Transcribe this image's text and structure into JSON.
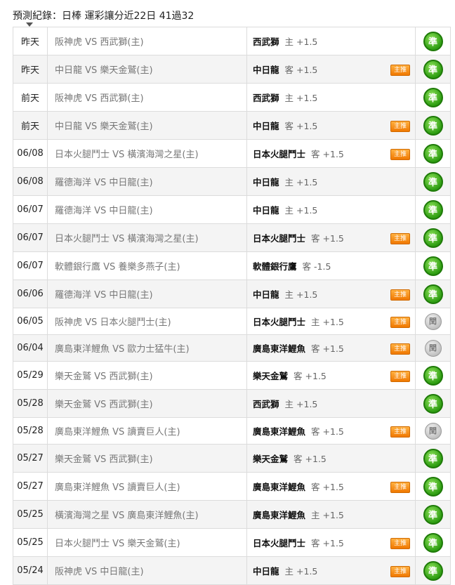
{
  "header": {
    "title": "預測紀錄：日棒 運彩讓分近22日 41過32"
  },
  "rows": [
    {
      "date": "昨天",
      "match": "阪神虎 VS 西武獅(主)",
      "pick": "西武獅",
      "side": "主",
      "line": "+1.5",
      "badge": "",
      "result": "準",
      "result_type": "win"
    },
    {
      "date": "昨天",
      "match": "中日龍 VS 樂天金鷲(主)",
      "pick": "中日龍",
      "side": "客",
      "line": "+1.5",
      "badge": "主推",
      "result": "準",
      "result_type": "win"
    },
    {
      "date": "前天",
      "match": "阪神虎 VS 西武獅(主)",
      "pick": "西武獅",
      "side": "主",
      "line": "+1.5",
      "badge": "",
      "result": "準",
      "result_type": "win"
    },
    {
      "date": "前天",
      "match": "中日龍 VS 樂天金鷲(主)",
      "pick": "中日龍",
      "side": "客",
      "line": "+1.5",
      "badge": "主推",
      "result": "準",
      "result_type": "win"
    },
    {
      "date": "06/08",
      "match": "日本火腿鬥士 VS 橫濱海灣之星(主)",
      "pick": "日本火腿鬥士",
      "side": "客",
      "line": "+1.5",
      "badge": "主推",
      "result": "準",
      "result_type": "win"
    },
    {
      "date": "06/08",
      "match": "羅德海洋 VS 中日龍(主)",
      "pick": "中日龍",
      "side": "主",
      "line": "+1.5",
      "badge": "",
      "result": "準",
      "result_type": "win"
    },
    {
      "date": "06/07",
      "match": "羅德海洋 VS 中日龍(主)",
      "pick": "中日龍",
      "side": "主",
      "line": "+1.5",
      "badge": "",
      "result": "準",
      "result_type": "win"
    },
    {
      "date": "06/07",
      "match": "日本火腿鬥士 VS 橫濱海灣之星(主)",
      "pick": "日本火腿鬥士",
      "side": "客",
      "line": "+1.5",
      "badge": "主推",
      "result": "準",
      "result_type": "win"
    },
    {
      "date": "06/07",
      "match": "軟體銀行鷹 VS 養樂多燕子(主)",
      "pick": "軟體銀行鷹",
      "side": "客",
      "line": "-1.5",
      "badge": "",
      "result": "準",
      "result_type": "win"
    },
    {
      "date": "06/06",
      "match": "羅德海洋 VS 中日龍(主)",
      "pick": "中日龍",
      "side": "主",
      "line": "+1.5",
      "badge": "主推",
      "result": "準",
      "result_type": "win"
    },
    {
      "date": "06/05",
      "match": "阪神虎 VS 日本火腿鬥士(主)",
      "pick": "日本火腿鬥士",
      "side": "主",
      "line": "+1.5",
      "badge": "主推",
      "result": "閏",
      "result_type": "push"
    },
    {
      "date": "06/04",
      "match": "廣島東洋鯉魚 VS 歐力士猛牛(主)",
      "pick": "廣島東洋鯉魚",
      "side": "客",
      "line": "+1.5",
      "badge": "主推",
      "result": "閏",
      "result_type": "push"
    },
    {
      "date": "05/29",
      "match": "樂天金鷲 VS 西武獅(主)",
      "pick": "樂天金鷲",
      "side": "客",
      "line": "+1.5",
      "badge": "主推",
      "result": "準",
      "result_type": "win"
    },
    {
      "date": "05/28",
      "match": "樂天金鷲 VS 西武獅(主)",
      "pick": "西武獅",
      "side": "主",
      "line": "+1.5",
      "badge": "",
      "result": "準",
      "result_type": "win"
    },
    {
      "date": "05/28",
      "match": "廣島東洋鯉魚 VS 讀賣巨人(主)",
      "pick": "廣島東洋鯉魚",
      "side": "客",
      "line": "+1.5",
      "badge": "主推",
      "result": "閏",
      "result_type": "push"
    },
    {
      "date": "05/27",
      "match": "樂天金鷲 VS 西武獅(主)",
      "pick": "樂天金鷲",
      "side": "客",
      "line": "+1.5",
      "badge": "",
      "result": "準",
      "result_type": "win"
    },
    {
      "date": "05/27",
      "match": "廣島東洋鯉魚 VS 讀賣巨人(主)",
      "pick": "廣島東洋鯉魚",
      "side": "客",
      "line": "+1.5",
      "badge": "主推",
      "result": "準",
      "result_type": "win"
    },
    {
      "date": "05/25",
      "match": "橫濱海灣之星 VS 廣島東洋鯉魚(主)",
      "pick": "廣島東洋鯉魚",
      "side": "主",
      "line": "+1.5",
      "badge": "",
      "result": "準",
      "result_type": "win"
    },
    {
      "date": "05/25",
      "match": "日本火腿鬥士 VS 樂天金鷲(主)",
      "pick": "日本火腿鬥士",
      "side": "客",
      "line": "+1.5",
      "badge": "主推",
      "result": "準",
      "result_type": "win"
    },
    {
      "date": "05/24",
      "match": "阪神虎 VS 中日龍(主)",
      "pick": "中日龍",
      "side": "主",
      "line": "+1.5",
      "badge": "主推",
      "result": "準",
      "result_type": "win"
    }
  ]
}
